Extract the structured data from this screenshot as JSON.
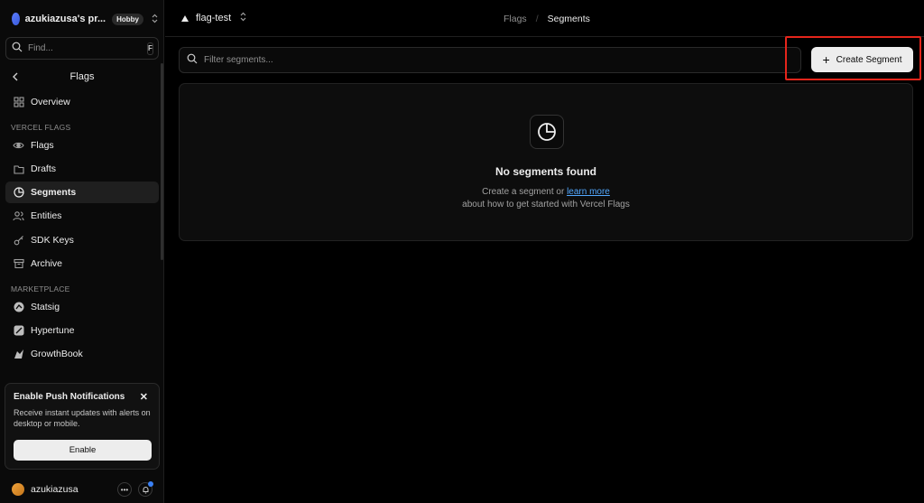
{
  "sidebar": {
    "team_name": "azukiazusa's pr...",
    "plan_badge": "Hobby",
    "find_placeholder": "Find...",
    "find_shortcut": "F",
    "header_title": "Flags",
    "nav_top": [
      {
        "label": "Overview",
        "icon": "grid-icon"
      }
    ],
    "section_vercel_flags": "VERCEL FLAGS",
    "nav_flags": [
      {
        "label": "Flags",
        "icon": "eye-icon"
      },
      {
        "label": "Drafts",
        "icon": "folder-icon"
      },
      {
        "label": "Segments",
        "icon": "pie-chart-icon",
        "active": true
      },
      {
        "label": "Entities",
        "icon": "users-icon"
      },
      {
        "label": "SDK Keys",
        "icon": "key-icon"
      },
      {
        "label": "Archive",
        "icon": "archive-icon"
      }
    ],
    "section_marketplace": "MARKETPLACE",
    "nav_marketplace": [
      {
        "label": "Statsig",
        "icon": "statsig-icon"
      },
      {
        "label": "Hypertune",
        "icon": "hypertune-icon"
      },
      {
        "label": "GrowthBook",
        "icon": "growthbook-icon"
      }
    ],
    "notification": {
      "title": "Enable Push Notifications",
      "text": "Receive instant updates with alerts on desktop or mobile.",
      "button": "Enable"
    },
    "user_name": "azukiazusa"
  },
  "topbar": {
    "project": "flag-test",
    "breadcrumb": [
      "Flags",
      "Segments"
    ]
  },
  "main": {
    "filter_placeholder": "Filter segments...",
    "create_button": "Create Segment",
    "empty_title": "No segments found",
    "empty_text_before": "Create a segment or ",
    "empty_link": "learn more",
    "empty_text_after": " about how to get started with Vercel Flags"
  },
  "colors": {
    "background": "#000000",
    "sidebar": "#0a0a0a",
    "highlight": "#e5251b",
    "link": "#52a8ff"
  }
}
